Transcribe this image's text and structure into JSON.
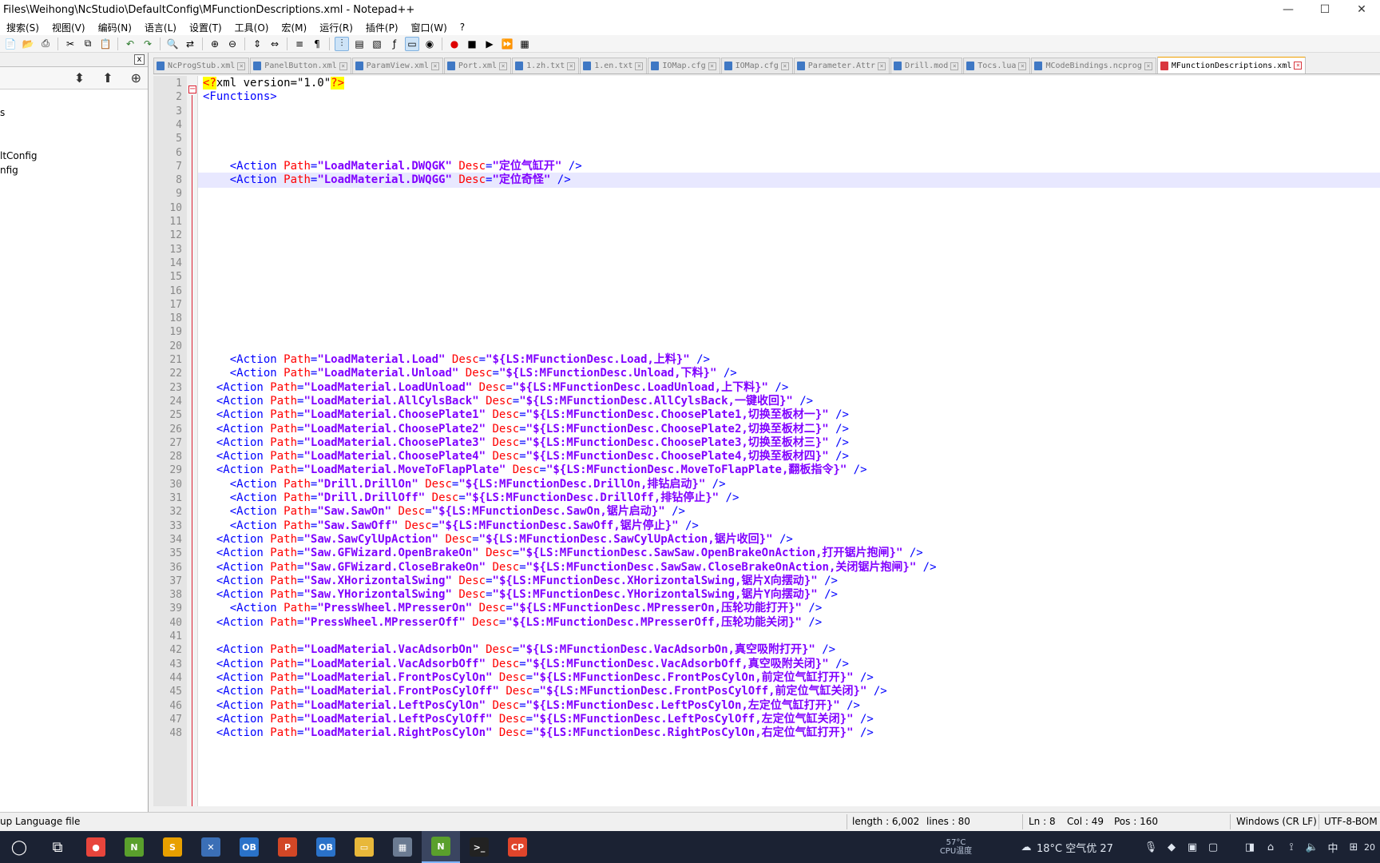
{
  "window": {
    "title": "Files\\Weihong\\NcStudio\\DefaultConfig\\MFunctionDescriptions.xml - Notepad++",
    "controls": [
      "—",
      "☐",
      "✕"
    ]
  },
  "menu": [
    "搜索(S)",
    "视图(V)",
    "编码(N)",
    "语言(L)",
    "设置(T)",
    "工具(O)",
    "宏(M)",
    "运行(R)",
    "插件(P)",
    "窗口(W)",
    "?"
  ],
  "left_panel": {
    "close": "x",
    "tree": [
      "",
      "s",
      "",
      "",
      "ltConfig",
      "nfig"
    ]
  },
  "tabs": [
    {
      "label": "NcProgStub.xml",
      "active": false
    },
    {
      "label": "PanelButton.xml",
      "active": false
    },
    {
      "label": "ParamView.xml",
      "active": false
    },
    {
      "label": "Port.xml",
      "active": false
    },
    {
      "label": "1.zh.txt",
      "active": false
    },
    {
      "label": "1.en.txt",
      "active": false
    },
    {
      "label": "IOMap.cfg",
      "active": false
    },
    {
      "label": "IOMap.cfg",
      "active": false
    },
    {
      "label": "Parameter.Attr",
      "active": false
    },
    {
      "label": "Drill.mod",
      "active": false
    },
    {
      "label": "Tocs.lua",
      "active": false
    },
    {
      "label": "MCodeBindings.ncprog",
      "active": false
    },
    {
      "label": "MFunctionDescriptions.xml",
      "active": true
    }
  ],
  "code_lines": [
    {
      "n": "1",
      "type": "pi",
      "parts": [
        [
          "pi",
          "<?"
        ],
        [
          "plain",
          "xml version=\"1.0\""
        ],
        [
          "pi",
          "?>"
        ]
      ]
    },
    {
      "n": "2",
      "type": "tag",
      "parts": [
        [
          "tag",
          "<Functions>"
        ]
      ]
    },
    {
      "n": "3",
      "parts": []
    },
    {
      "n": "4",
      "parts": []
    },
    {
      "n": "5",
      "parts": []
    },
    {
      "n": "6",
      "parts": []
    },
    {
      "n": "7",
      "indent": "    ",
      "parts": [
        [
          "tag",
          "<Action "
        ],
        [
          "attr",
          "Path"
        ],
        [
          "tag",
          "="
        ],
        [
          "val",
          "\"LoadMaterial.DWQGK\""
        ],
        [
          "tag",
          " "
        ],
        [
          "attr",
          "Desc"
        ],
        [
          "tag",
          "="
        ],
        [
          "val",
          "\"定位气缸开\""
        ],
        [
          "tag",
          " />"
        ]
      ]
    },
    {
      "n": "8",
      "indent": "    ",
      "current": true,
      "parts": [
        [
          "tag",
          "<Action "
        ],
        [
          "attr",
          "Path"
        ],
        [
          "tag",
          "="
        ],
        [
          "val",
          "\"LoadMaterial.DWQGG\""
        ],
        [
          "tag",
          " "
        ],
        [
          "attr",
          "Desc"
        ],
        [
          "tag",
          "="
        ],
        [
          "val",
          "\"定位奇怪\""
        ],
        [
          "tag",
          " />"
        ]
      ]
    },
    {
      "n": "9",
      "parts": []
    },
    {
      "n": "10",
      "parts": []
    },
    {
      "n": "11",
      "parts": []
    },
    {
      "n": "12",
      "parts": []
    },
    {
      "n": "13",
      "parts": []
    },
    {
      "n": "14",
      "parts": []
    },
    {
      "n": "15",
      "parts": []
    },
    {
      "n": "16",
      "parts": []
    },
    {
      "n": "17",
      "parts": []
    },
    {
      "n": "18",
      "parts": []
    },
    {
      "n": "19",
      "parts": []
    },
    {
      "n": "20",
      "parts": []
    },
    {
      "n": "21",
      "indent": "    ",
      "path": "LoadMaterial.Load",
      "desc": "${LS:MFunctionDesc.Load,上料}"
    },
    {
      "n": "22",
      "indent": "    ",
      "path": "LoadMaterial.Unload",
      "desc": "${LS:MFunctionDesc.Unload,下料}"
    },
    {
      "n": "23",
      "indent": "  ",
      "path": "LoadMaterial.LoadUnload",
      "desc": "${LS:MFunctionDesc.LoadUnload,上下料}"
    },
    {
      "n": "24",
      "indent": "  ",
      "path": "LoadMaterial.AllCylsBack",
      "desc": "${LS:MFunctionDesc.AllCylsBack,一键收回}"
    },
    {
      "n": "25",
      "indent": "  ",
      "path": "LoadMaterial.ChoosePlate1",
      "desc": "${LS:MFunctionDesc.ChoosePlate1,切换至板材一}"
    },
    {
      "n": "26",
      "indent": "  ",
      "path": "LoadMaterial.ChoosePlate2",
      "desc": "${LS:MFunctionDesc.ChoosePlate2,切换至板材二}"
    },
    {
      "n": "27",
      "indent": "  ",
      "path": "LoadMaterial.ChoosePlate3",
      "desc": "${LS:MFunctionDesc.ChoosePlate3,切换至板材三}"
    },
    {
      "n": "28",
      "indent": "  ",
      "path": "LoadMaterial.ChoosePlate4",
      "desc": "${LS:MFunctionDesc.ChoosePlate4,切换至板材四}"
    },
    {
      "n": "29",
      "indent": "  ",
      "path": "LoadMaterial.MoveToFlapPlate",
      "desc": "${LS:MFunctionDesc.MoveToFlapPlate,翻板指令}"
    },
    {
      "n": "30",
      "indent": "    ",
      "path": "Drill.DrillOn",
      "desc": "${LS:MFunctionDesc.DrillOn,排钻启动}"
    },
    {
      "n": "31",
      "indent": "    ",
      "path": "Drill.DrillOff",
      "desc": "${LS:MFunctionDesc.DrillOff,排钻停止}"
    },
    {
      "n": "32",
      "indent": "    ",
      "path": "Saw.SawOn",
      "desc": "${LS:MFunctionDesc.SawOn,锯片启动}"
    },
    {
      "n": "33",
      "indent": "    ",
      "path": "Saw.SawOff",
      "desc": "${LS:MFunctionDesc.SawOff,锯片停止}"
    },
    {
      "n": "34",
      "indent": "  ",
      "path": "Saw.SawCylUpAction",
      "desc": "${LS:MFunctionDesc.SawCylUpAction,锯片收回}"
    },
    {
      "n": "35",
      "indent": "  ",
      "path": "Saw.GFWizard.OpenBrakeOn",
      "desc": "${LS:MFunctionDesc.SawSaw.OpenBrakeOnAction,打开锯片抱闸}"
    },
    {
      "n": "36",
      "indent": "  ",
      "path": "Saw.GFWizard.CloseBrakeOn",
      "desc": "${LS:MFunctionDesc.SawSaw.CloseBrakeOnAction,关闭锯片抱闸}"
    },
    {
      "n": "37",
      "indent": "  ",
      "path": "Saw.XHorizontalSwing",
      "desc": "${LS:MFunctionDesc.XHorizontalSwing,锯片X向摆动}"
    },
    {
      "n": "38",
      "indent": "  ",
      "path": "Saw.YHorizontalSwing",
      "desc": "${LS:MFunctionDesc.YHorizontalSwing,锯片Y向摆动}"
    },
    {
      "n": "39",
      "indent": "    ",
      "path": "PressWheel.MPresserOn",
      "desc": "${LS:MFunctionDesc.MPresserOn,压轮功能打开}"
    },
    {
      "n": "40",
      "indent": "  ",
      "path": "PressWheel.MPresserOff",
      "desc": "${LS:MFunctionDesc.MPresserOff,压轮功能关闭}"
    },
    {
      "n": "41",
      "parts": []
    },
    {
      "n": "42",
      "indent": "  ",
      "path": "LoadMaterial.VacAdsorbOn",
      "desc": "${LS:MFunctionDesc.VacAdsorbOn,真空吸附打开}"
    },
    {
      "n": "43",
      "indent": "  ",
      "path": "LoadMaterial.VacAdsorbOff",
      "desc": "${LS:MFunctionDesc.VacAdsorbOff,真空吸附关闭}"
    },
    {
      "n": "44",
      "indent": "  ",
      "path": "LoadMaterial.FrontPosCylOn",
      "desc": "${LS:MFunctionDesc.FrontPosCylOn,前定位气缸打开}"
    },
    {
      "n": "45",
      "indent": "  ",
      "path": "LoadMaterial.FrontPosCylOff",
      "desc": "${LS:MFunctionDesc.FrontPosCylOff,前定位气缸关闭}"
    },
    {
      "n": "46",
      "indent": "  ",
      "path": "LoadMaterial.LeftPosCylOn",
      "desc": "${LS:MFunctionDesc.LeftPosCylOn,左定位气缸打开}"
    },
    {
      "n": "47",
      "indent": "  ",
      "path": "LoadMaterial.LeftPosCylOff",
      "desc": "${LS:MFunctionDesc.LeftPosCylOff,左定位气缸关闭}"
    },
    {
      "n": "48",
      "indent": "  ",
      "path": "LoadMaterial.RightPosCylOn",
      "desc": "${LS:MFunctionDesc.RightPosCylOn,右定位气缸打开}"
    }
  ],
  "status": {
    "filetype": "up Language file",
    "length": "length : 6,002",
    "lines": "lines : 80",
    "ln": "Ln : 8",
    "col": "Col : 49",
    "pos": "Pos : 160",
    "eol": "Windows (CR LF)",
    "encoding": "UTF-8-BOM"
  },
  "taskbar": {
    "apps": [
      {
        "name": "cortana-icon",
        "glyph": "◯"
      },
      {
        "name": "task-view-icon",
        "glyph": "⧉"
      },
      {
        "name": "chrome-icon",
        "glyph": "●",
        "color": "#e8453c"
      },
      {
        "name": "notepadpp-icon",
        "glyph": "N",
        "color": "#5aa02c"
      },
      {
        "name": "app-s-icon",
        "glyph": "S",
        "color": "#e8a000"
      },
      {
        "name": "app-tool-icon",
        "glyph": "✕",
        "color": "#3b6fb6"
      },
      {
        "name": "outlook-icon",
        "glyph": "OB",
        "color": "#2a72c9"
      },
      {
        "name": "powerpoint-icon",
        "glyph": "P",
        "color": "#d24726"
      },
      {
        "name": "outlook2-icon",
        "glyph": "OB",
        "color": "#2a72c9"
      },
      {
        "name": "explorer-icon",
        "glyph": "▭",
        "color": "#e8b83a"
      },
      {
        "name": "app-calc-icon",
        "glyph": "▦",
        "color": "#6b7b92"
      },
      {
        "name": "notepadpp-active-icon",
        "glyph": "N",
        "color": "#5aa02c",
        "active": true
      },
      {
        "name": "terminal-icon",
        "glyph": ">_",
        "color": "#222"
      },
      {
        "name": "app-cp-icon",
        "glyph": "CP",
        "color": "#e0452b"
      }
    ],
    "cpu_temp": "57°C",
    "cpu_label": "CPU温度",
    "weather": "18°C  空气优 27",
    "ime": "中",
    "time": "20"
  }
}
